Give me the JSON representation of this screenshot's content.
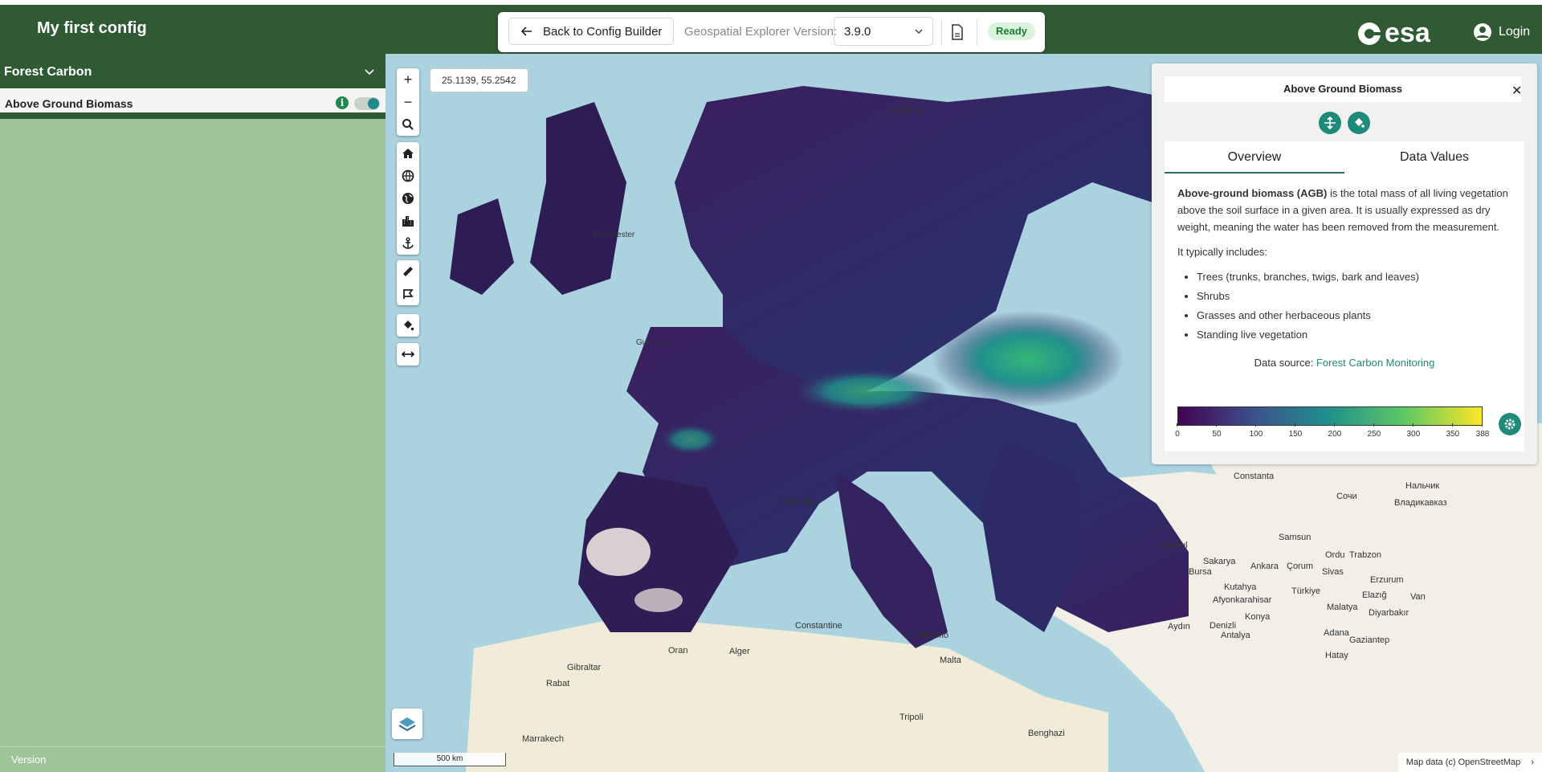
{
  "header": {
    "title": "My first config",
    "back_label": "Back to Config Builder",
    "version_label": "Geospatial Explorer Version:",
    "version_value": "3.9.0",
    "status": "Ready",
    "logo_text": "esa",
    "login_label": "Login"
  },
  "sidebar": {
    "group_title": "Forest Carbon",
    "layer_label": "Above Ground Biomass",
    "layer_enabled": true,
    "footer": "Version"
  },
  "map": {
    "coords": "25.1139, 55.2542",
    "scale": "500 km",
    "attribution": "Map data (c) OpenStreetMap",
    "places": [
      "Constanta",
      "Нальчик",
      "Сочи",
      "Владикавказ",
      "Samsun",
      "Ordu",
      "Trabzon",
      "Istanbul",
      "Sakarya",
      "Bursa",
      "Ankara",
      "Çorum",
      "Sivas",
      "Erzurum",
      "Kutahya",
      "Türkiye",
      "Elazığ",
      "Van",
      "Afyonkarahisar",
      "Malatya",
      "Diyarbakır",
      "Konya",
      "Denizli",
      "Aydın",
      "Antalya",
      "Adana",
      "Gaziantep",
      "Hatay",
      "Marseille",
      "Palermo",
      "Malta",
      "Constantine",
      "Oran",
      "Alger",
      "Gibraltar",
      "Rabat",
      "Tripoli",
      "Benghazi",
      "Marrakech",
      "Guernsey",
      "Manchester",
      "Göteborg"
    ]
  },
  "panel": {
    "title": "Above Ground Biomass",
    "tabs": [
      "Overview",
      "Data Values"
    ],
    "intro_bold": "Above-ground biomass (AGB)",
    "intro_rest": " is the total mass of all living vegetation above the soil surface in a given area. It is usually expressed as dry weight, meaning the water has been removed from the measurement.",
    "includes": "It typically includes:",
    "items": [
      "Trees (trunks, branches, twigs, bark and leaves)",
      "Shrubs",
      "Grasses and other herbaceous plants",
      "Standing live vegetation"
    ],
    "source_label": "Data source:",
    "source_link": "Forest Carbon Monitoring",
    "colorbar_ticks": [
      "0",
      "50",
      "100",
      "150",
      "200",
      "250",
      "300",
      "350",
      "388"
    ],
    "colorbar_min": 0,
    "colorbar_max": 388
  },
  "colors": {
    "header_bg": "#2f5a33",
    "sidebar_bg": "#9fc49a",
    "accent": "#1f8a7a",
    "ready_bg": "#d9f3dc"
  }
}
